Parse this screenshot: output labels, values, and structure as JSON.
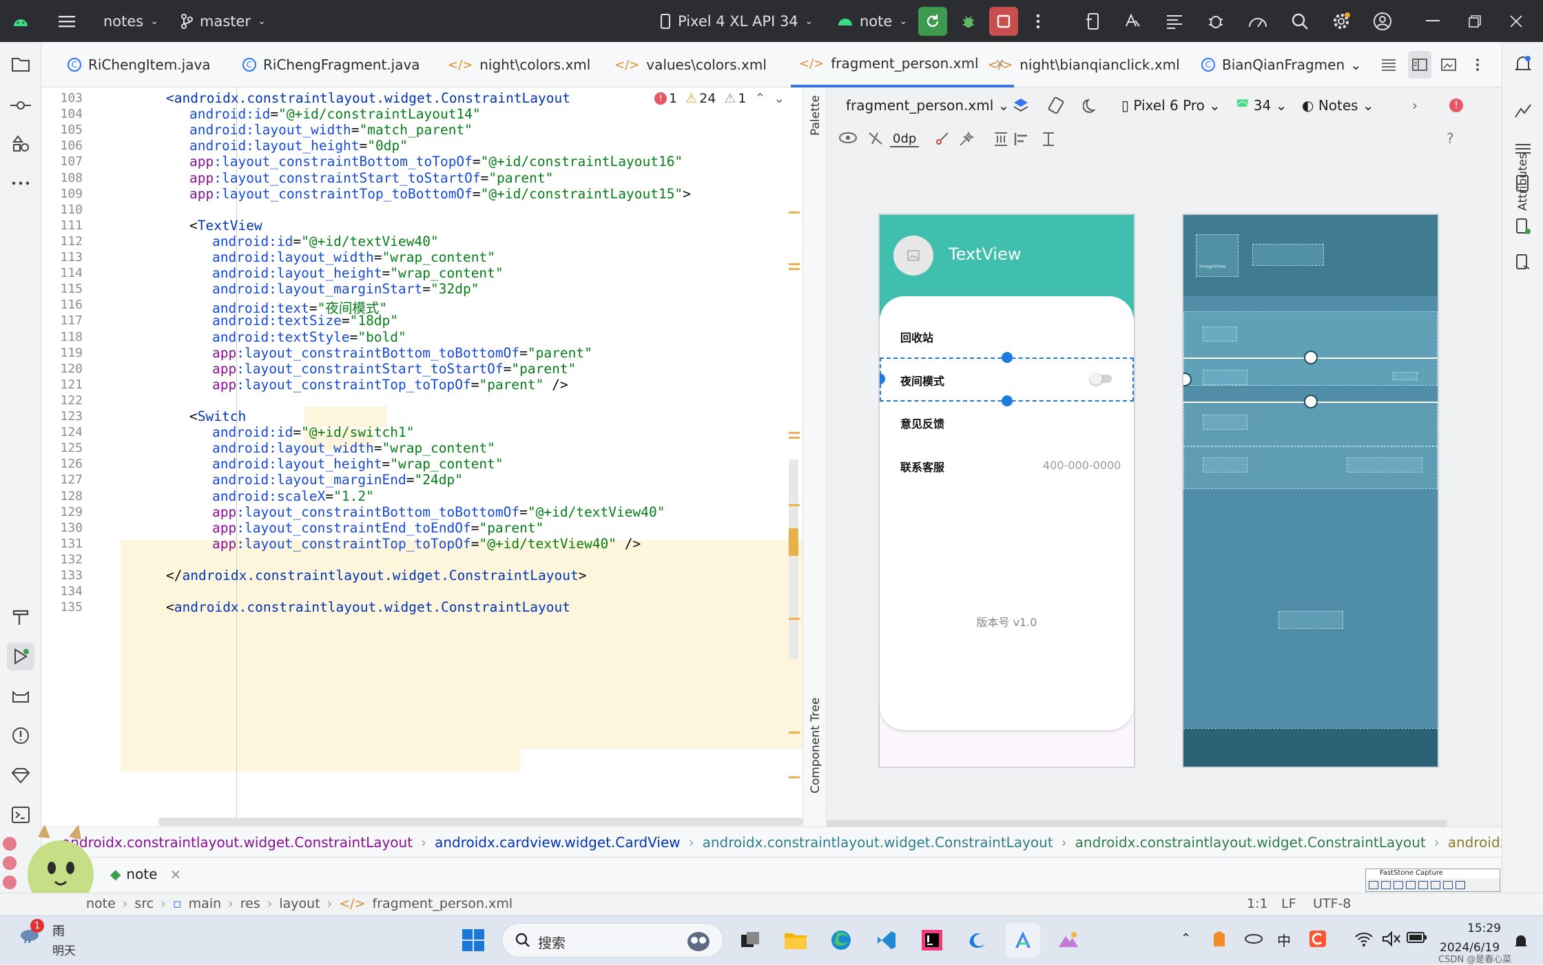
{
  "titlebar": {
    "project": "notes",
    "branch": "master",
    "device": "Pixel 4 XL API 34",
    "run_config": "note"
  },
  "tabs": [
    {
      "label": "RiChengItem.java",
      "type": "java"
    },
    {
      "label": "RiChengFragment.java",
      "type": "java"
    },
    {
      "label": "night\\colors.xml",
      "type": "xml"
    },
    {
      "label": "values\\colors.xml",
      "type": "xml"
    },
    {
      "label": "fragment_person.xml",
      "type": "xml",
      "active": true
    },
    {
      "label": "night\\bianqianclick.xml",
      "type": "xml"
    },
    {
      "label": "BianQianFragmen",
      "type": "java"
    }
  ],
  "editor": {
    "inspection": {
      "errors": "1",
      "warnings": "24",
      "weak": "1"
    },
    "line_numbers": [
      "103",
      "104",
      "105",
      "106",
      "107",
      "108",
      "109",
      "110",
      "111",
      "112",
      "113",
      "114",
      "115",
      "116",
      "117",
      "118",
      "119",
      "120",
      "121",
      "122",
      "123",
      "124",
      "125",
      "126",
      "127",
      "128",
      "129",
      "130",
      "131",
      "132",
      "133",
      "134",
      "135"
    ],
    "lines": [
      {
        "indent": 0,
        "parts": [
          [
            "t",
            "<androidx.constraintlayout.widget.ConstraintLayout"
          ]
        ]
      },
      {
        "indent": 1,
        "parts": [
          [
            "a",
            "android:id"
          ],
          [
            "p",
            "="
          ],
          [
            "s",
            "\"@+id/constraintLayout14\""
          ]
        ]
      },
      {
        "indent": 1,
        "parts": [
          [
            "a",
            "android:layout_width"
          ],
          [
            "p",
            "="
          ],
          [
            "s",
            "\"match_parent\""
          ]
        ]
      },
      {
        "indent": 1,
        "parts": [
          [
            "a",
            "android:layout_height"
          ],
          [
            "p",
            "="
          ],
          [
            "s",
            "\"0dp\""
          ]
        ]
      },
      {
        "indent": 1,
        "parts": [
          [
            "ns",
            "app"
          ],
          [
            "a",
            ":layout_constraintBottom_toTopOf"
          ],
          [
            "p",
            "="
          ],
          [
            "s",
            "\"@+id/constraintLayout16\""
          ]
        ]
      },
      {
        "indent": 1,
        "parts": [
          [
            "ns",
            "app"
          ],
          [
            "a",
            ":layout_constraintStart_toStartOf"
          ],
          [
            "p",
            "="
          ],
          [
            "s",
            "\"parent\""
          ]
        ]
      },
      {
        "indent": 1,
        "parts": [
          [
            "ns",
            "app"
          ],
          [
            "a",
            ":layout_constraintTop_toBottomOf"
          ],
          [
            "p",
            "="
          ],
          [
            "s",
            "\"@+id/constraintLayout15\""
          ],
          [
            "p",
            ">"
          ]
        ]
      },
      {
        "indent": 1,
        "parts": []
      },
      {
        "indent": 1,
        "parts": [
          [
            "p",
            "<"
          ],
          [
            "t",
            "TextView"
          ]
        ]
      },
      {
        "indent": 2,
        "parts": [
          [
            "a",
            "android:id"
          ],
          [
            "p",
            "="
          ],
          [
            "s",
            "\"@+id/textView40\""
          ]
        ]
      },
      {
        "indent": 2,
        "parts": [
          [
            "a",
            "android:layout_width"
          ],
          [
            "p",
            "="
          ],
          [
            "s",
            "\"wrap_content\""
          ]
        ]
      },
      {
        "indent": 2,
        "parts": [
          [
            "a",
            "android:layout_height"
          ],
          [
            "p",
            "="
          ],
          [
            "s",
            "\"wrap_content\""
          ]
        ]
      },
      {
        "indent": 2,
        "parts": [
          [
            "a",
            "android:layout_marginStart"
          ],
          [
            "p",
            "="
          ],
          [
            "s",
            "\"32dp\""
          ]
        ]
      },
      {
        "indent": 2,
        "parts": [
          [
            "a",
            "android:text"
          ],
          [
            "p",
            "="
          ],
          [
            "s",
            "\"夜间模式\""
          ]
        ]
      },
      {
        "indent": 2,
        "parts": [
          [
            "a",
            "android:textSize"
          ],
          [
            "p",
            "="
          ],
          [
            "s",
            "\"18dp\""
          ]
        ]
      },
      {
        "indent": 2,
        "parts": [
          [
            "a",
            "android:textStyle"
          ],
          [
            "p",
            "="
          ],
          [
            "s",
            "\"bold\""
          ]
        ]
      },
      {
        "indent": 2,
        "parts": [
          [
            "ns",
            "app"
          ],
          [
            "a",
            ":layout_constraintBottom_toBottomOf"
          ],
          [
            "p",
            "="
          ],
          [
            "s",
            "\"parent\""
          ]
        ]
      },
      {
        "indent": 2,
        "parts": [
          [
            "ns",
            "app"
          ],
          [
            "a",
            ":layout_constraintStart_toStartOf"
          ],
          [
            "p",
            "="
          ],
          [
            "s",
            "\"parent\""
          ]
        ]
      },
      {
        "indent": 2,
        "parts": [
          [
            "ns",
            "app"
          ],
          [
            "a",
            ":layout_constraintTop_toTopOf"
          ],
          [
            "p",
            "="
          ],
          [
            "s",
            "\"parent\""
          ],
          [
            "p",
            " />"
          ]
        ]
      },
      {
        "indent": 1,
        "parts": []
      },
      {
        "indent": 1,
        "parts": [
          [
            "p",
            "<"
          ],
          [
            "t",
            "Switch"
          ]
        ]
      },
      {
        "indent": 2,
        "parts": [
          [
            "a",
            "android:id"
          ],
          [
            "p",
            "="
          ],
          [
            "s",
            "\"@+id/switch1\""
          ]
        ]
      },
      {
        "indent": 2,
        "parts": [
          [
            "a",
            "android:layout_width"
          ],
          [
            "p",
            "="
          ],
          [
            "s",
            "\"wrap_content\""
          ]
        ]
      },
      {
        "indent": 2,
        "parts": [
          [
            "a",
            "android:layout_height"
          ],
          [
            "p",
            "="
          ],
          [
            "s",
            "\"wrap_content\""
          ]
        ]
      },
      {
        "indent": 2,
        "parts": [
          [
            "a",
            "android:layout_marginEnd"
          ],
          [
            "p",
            "="
          ],
          [
            "s",
            "\"24dp\""
          ]
        ]
      },
      {
        "indent": 2,
        "parts": [
          [
            "a",
            "android:scaleX"
          ],
          [
            "p",
            "="
          ],
          [
            "s",
            "\"1.2\""
          ]
        ]
      },
      {
        "indent": 2,
        "parts": [
          [
            "ns",
            "app"
          ],
          [
            "a",
            ":layout_constraintBottom_toBottomOf"
          ],
          [
            "p",
            "="
          ],
          [
            "s",
            "\"@+id/textView40\""
          ]
        ]
      },
      {
        "indent": 2,
        "parts": [
          [
            "ns",
            "app"
          ],
          [
            "a",
            ":layout_constraintEnd_toEndOf"
          ],
          [
            "p",
            "="
          ],
          [
            "s",
            "\"parent\""
          ]
        ]
      },
      {
        "indent": 2,
        "parts": [
          [
            "ns",
            "app"
          ],
          [
            "a",
            ":layout_constraintTop_toTopOf"
          ],
          [
            "p",
            "="
          ],
          [
            "s",
            "\"@+id/textView40\""
          ],
          [
            "p",
            " />"
          ]
        ]
      },
      {
        "indent": 1,
        "parts": []
      },
      {
        "indent": 0,
        "parts": [
          [
            "p",
            "</"
          ],
          [
            "t",
            "androidx.constraintlayout.widget.ConstraintLayout"
          ],
          [
            "p",
            ">"
          ]
        ]
      },
      {
        "indent": 0,
        "parts": []
      },
      {
        "indent": 0,
        "parts": [
          [
            "p",
            "<"
          ],
          [
            "t",
            "androidx.constraintlayout.widget.ConstraintLayout"
          ]
        ]
      }
    ]
  },
  "design": {
    "file": "fragment_person.xml",
    "device": "Pixel 6 Pro",
    "api": "34",
    "theme": "Notes",
    "margin": "0dp",
    "side_palette": "Palette",
    "side_tree": "Component Tree",
    "side_attributes": "Attributes"
  },
  "preview": {
    "header_title": "TextView",
    "rows": [
      "回收站",
      "夜间模式",
      "意见反馈",
      "联系客服"
    ],
    "phone": "400-000-0000",
    "version": "版本号 v1.0",
    "blueprint_image_label": "ImageView"
  },
  "breadcrumb": [
    "androidx.constraintlayout.widget.ConstraintLayout",
    "androidx.cardview.widget.CardView",
    "androidx.constraintlayout.widget.ConstraintLayout",
    "androidx.constraintlayout.widget.ConstraintLayout",
    "androidx.constraintlayou"
  ],
  "runbar": {
    "label": "note"
  },
  "status": {
    "path": [
      "note",
      "src",
      "main",
      "res",
      "layout",
      "fragment_person.xml"
    ],
    "position": "1:1",
    "line_sep": "LF",
    "encoding": "UTF-8"
  },
  "faststone": {
    "title": "FastStone Capture"
  },
  "taskbar": {
    "weather_badge": "1",
    "weather_title": "雨",
    "weather_sub": "明天",
    "search_placeholder": "搜索",
    "ime": "中",
    "time": "15:29",
    "date": "2024/6/19",
    "watermark": "CSDN @是春心菜"
  },
  "colors": {
    "accent": "#3574f0",
    "teal": "#41bfae",
    "blueprint": "#4f8ea6",
    "tag": "#0033b3",
    "string": "#067d17"
  }
}
